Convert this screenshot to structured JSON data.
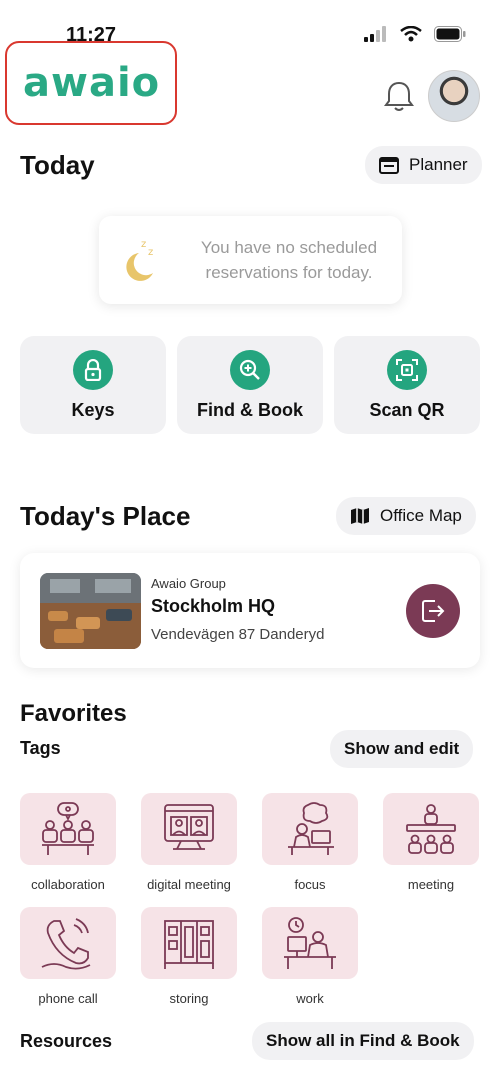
{
  "status_bar": {
    "time": "11:27"
  },
  "brand": {
    "logo_text": "awaio",
    "color": "#2aa985"
  },
  "today": {
    "title": "Today",
    "planner_label": "Planner",
    "no_reservations": "You have no scheduled reservations for today."
  },
  "actions": [
    {
      "label": "Keys",
      "icon": "lock-icon"
    },
    {
      "label": "Find & Book",
      "icon": "zoom-search-icon"
    },
    {
      "label": "Scan QR",
      "icon": "qr-scan-icon"
    }
  ],
  "todays_place": {
    "title": "Today's Place",
    "office_map_label": "Office Map",
    "company": "Awaio Group",
    "name": "Stockholm HQ",
    "address": "Vendevägen 87 Danderyd"
  },
  "favorites": {
    "title": "Favorites",
    "tags_title": "Tags",
    "show_edit_label": "Show and edit",
    "tags": [
      {
        "label": "collaboration",
        "icon": "collaboration-icon"
      },
      {
        "label": "digital meeting",
        "icon": "digital-meeting-icon"
      },
      {
        "label": "focus",
        "icon": "focus-icon"
      },
      {
        "label": "meeting",
        "icon": "meeting-icon"
      },
      {
        "label": "phone call",
        "icon": "phone-call-icon"
      },
      {
        "label": "storing",
        "icon": "storing-icon"
      },
      {
        "label": "work",
        "icon": "work-icon"
      }
    ],
    "resources_title": "Resources",
    "show_all_label": "Show all in Find & Book"
  },
  "colors": {
    "accent_green": "#24a57f",
    "tag_bg": "#f6e3e7",
    "tag_icon": "#7b3a55",
    "checkout": "#7b3a55"
  }
}
